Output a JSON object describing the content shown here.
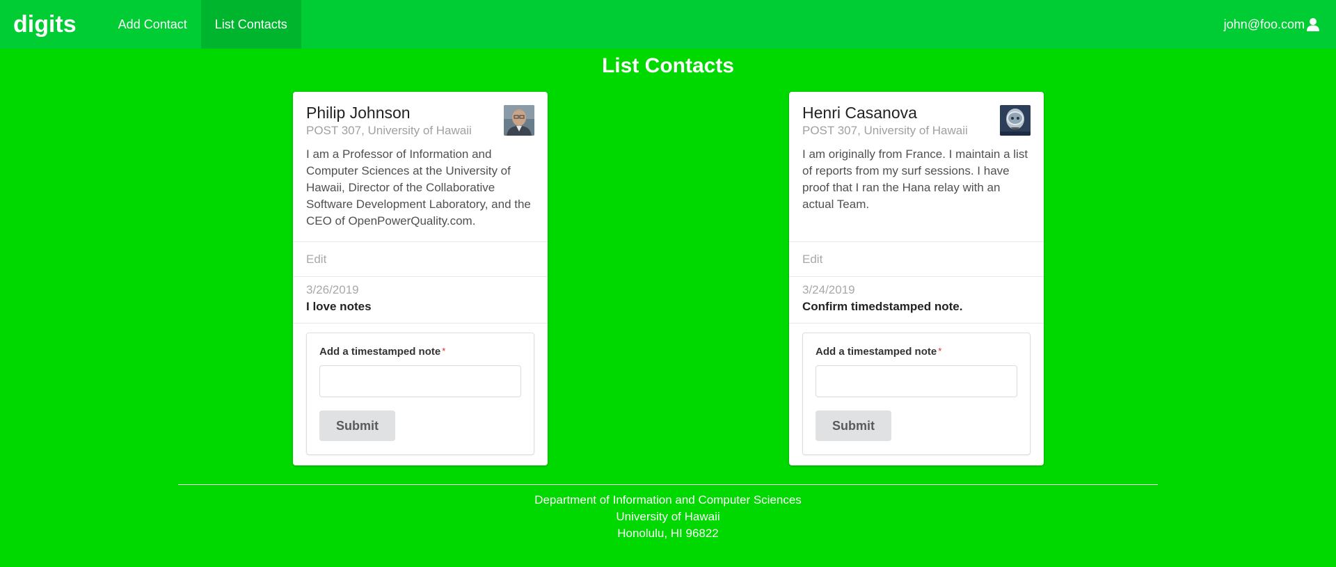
{
  "navbar": {
    "brand": "digits",
    "items": [
      {
        "label": "Add Contact",
        "active": false
      },
      {
        "label": "List Contacts",
        "active": true
      }
    ],
    "user_email": "john@foo.com",
    "user_icon": "user-icon"
  },
  "page": {
    "title": "List Contacts"
  },
  "contacts": [
    {
      "name": "Philip Johnson",
      "address": "POST 307, University of Hawaii",
      "description": "I am a Professor of Information and Computer Sciences at the University of Hawaii, Director of the Collaborative Software Development Laboratory, and the CEO of OpenPowerQuality.com.",
      "edit_label": "Edit",
      "note": {
        "date": "3/26/2019",
        "text": "I love notes"
      },
      "form": {
        "label": "Add a timestamped note",
        "required_mark": "*",
        "input_value": "",
        "submit_label": "Submit"
      }
    },
    {
      "name": "Henri Casanova",
      "address": "POST 307, University of Hawaii",
      "description": "I am originally from France. I maintain a list of reports from my surf sessions. I have proof that I ran the Hana relay with an actual Team.",
      "edit_label": "Edit",
      "note": {
        "date": "3/24/2019",
        "text": "Confirm timedstamped note."
      },
      "form": {
        "label": "Add a timestamped note",
        "required_mark": "*",
        "input_value": "",
        "submit_label": "Submit"
      }
    }
  ],
  "footer": {
    "line1": "Department of Information and Computer Sciences",
    "line2": "University of Hawaii",
    "line3": "Honolulu, HI 96822"
  },
  "colors": {
    "page_bg": "#00d900",
    "navbar_bg": "#00cc33",
    "nav_active_bg": "#00b52e"
  }
}
